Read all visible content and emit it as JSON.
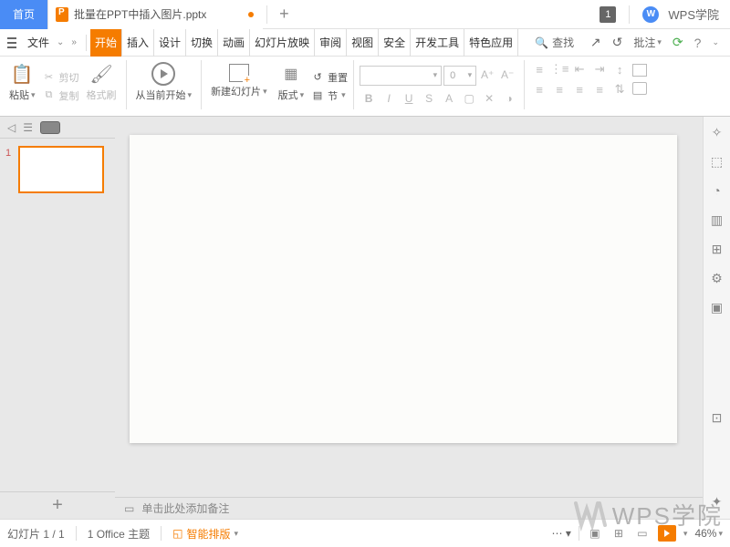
{
  "titlebar": {
    "home_tab": "首页",
    "doc_name": "批量在PPT中插入图片.pptx",
    "count_badge": "1",
    "brand": "WPS学院"
  },
  "menubar": {
    "file": "文件",
    "tabs": [
      "开始",
      "插入",
      "设计",
      "切换",
      "动画",
      "幻灯片放映",
      "审阅",
      "视图",
      "安全",
      "开发工具",
      "特色应用"
    ],
    "search": "查找",
    "approve": "批注"
  },
  "ribbon": {
    "paste": "粘贴",
    "cut": "剪切",
    "copy": "复制",
    "format_painter": "格式刷",
    "from_current": "从当前开始",
    "new_slide": "新建幻灯片",
    "layout": "版式",
    "section": "节",
    "reset": "重置",
    "font_size": "0"
  },
  "panel": {
    "thumb_num": "1"
  },
  "notes": {
    "placeholder": "单击此处添加备注"
  },
  "statusbar": {
    "slide_counter": "幻灯片 1 / 1",
    "theme": "1  Office 主题",
    "smart_layout": "智能排版",
    "zoom": "46%"
  },
  "watermark": "WPS学院"
}
